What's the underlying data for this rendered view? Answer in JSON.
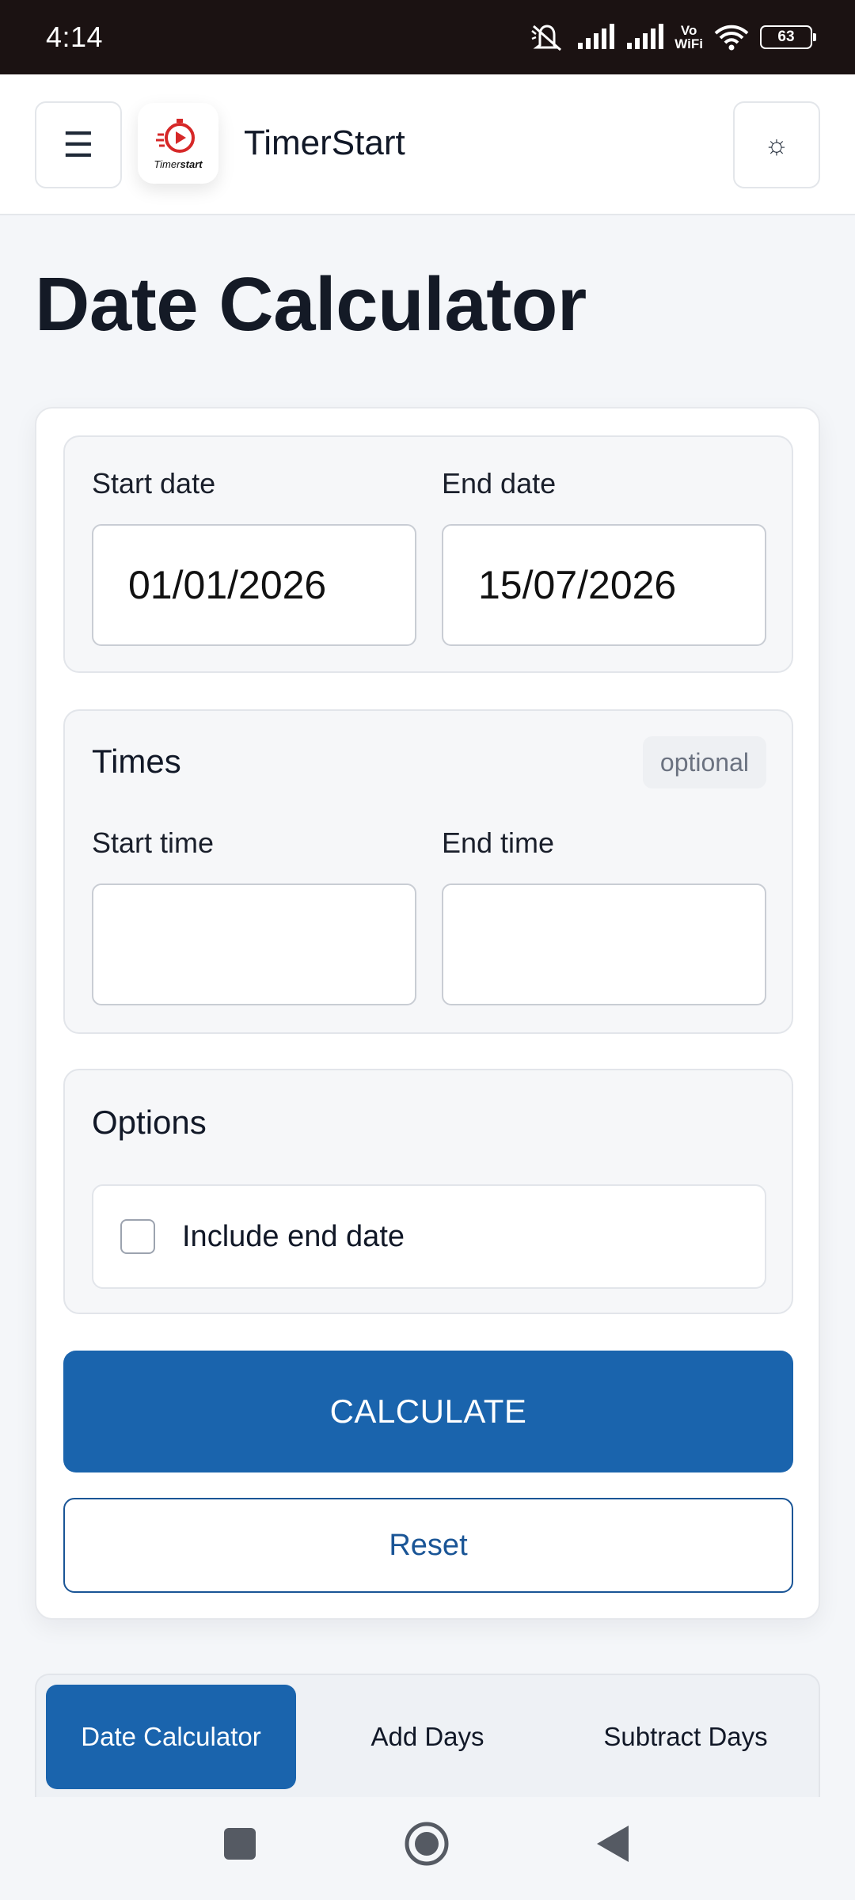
{
  "status_bar": {
    "time": "4:14",
    "vowifi_top": "Vo",
    "vowifi_bottom": "WiFi",
    "battery": "63"
  },
  "header": {
    "brand_name": "TimerStart",
    "logo_text_a": "Timer",
    "logo_text_b": "start",
    "menu_icon": "☰",
    "theme_icon": "☼"
  },
  "page": {
    "title": "Date Calculator"
  },
  "dates": {
    "start_label": "Start date",
    "start_value": "01/01/2026",
    "end_label": "End date",
    "end_value": "15/07/2026"
  },
  "times": {
    "heading": "Times",
    "badge": "optional",
    "start_label": "Start time",
    "start_value": "",
    "end_label": "End time",
    "end_value": ""
  },
  "options": {
    "heading": "Options",
    "include_end_date_label": "Include end date",
    "include_end_date_checked": false
  },
  "actions": {
    "calculate_label": "CALCULATE",
    "reset_label": "Reset"
  },
  "tabs": {
    "items": [
      {
        "label": "Date Calculator",
        "active": true
      },
      {
        "label": "Add Days",
        "active": false
      },
      {
        "label": "Subtract Days",
        "active": false
      }
    ]
  },
  "colors": {
    "accent": "#1a64ad",
    "status_bar_bg": "#1b1212",
    "logo_red": "#d62828"
  },
  "nav_bar": {
    "icons": [
      "recent-apps-icon",
      "home-icon",
      "back-icon"
    ]
  }
}
